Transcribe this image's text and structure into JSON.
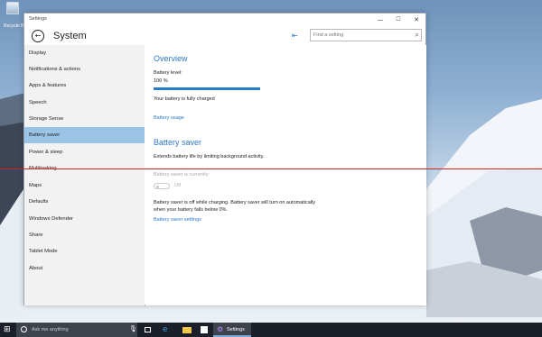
{
  "desktop": {
    "recycle_label": "Recycle Bin"
  },
  "window": {
    "title": "Settings",
    "controls": {
      "minimize": "—",
      "maximize": "☐",
      "close": "✕"
    }
  },
  "header": {
    "back_glyph": "←",
    "page_title": "System",
    "pin_glyph": "⇤",
    "search_placeholder": "Find a setting",
    "search_glyph": "⌕"
  },
  "sidebar": {
    "items": [
      {
        "label": "Display"
      },
      {
        "label": "Notifications & actions"
      },
      {
        "label": "Apps & features"
      },
      {
        "label": "Speech"
      },
      {
        "label": "Storage Sense"
      },
      {
        "label": "Battery saver",
        "selected": true
      },
      {
        "label": "Power & sleep"
      },
      {
        "label": "Multitasking"
      },
      {
        "label": "Maps"
      },
      {
        "label": "Defaults"
      },
      {
        "label": "Windows Defender"
      },
      {
        "label": "Share"
      },
      {
        "label": "Tablet Mode"
      },
      {
        "label": "About"
      }
    ]
  },
  "content": {
    "overview_title": "Overview",
    "battery_level_label": "Battery level:",
    "battery_level_value": "100 %",
    "battery_level_fraction": 1.0,
    "battery_status": "Your battery is fully charged",
    "battery_usage_link": "Battery usage",
    "saver_title": "Battery saver",
    "saver_desc": "Extends battery life by limiting background activity.",
    "saver_current_label": "Battery saver is currently:",
    "toggle_state": "Off",
    "saver_note": "Battery saver is off while charging. Battery saver will turn on automatically when your battery falls below 0%.",
    "saver_settings_link": "Battery saver settings"
  },
  "colors": {
    "accent": "#2b78c6",
    "selected_bg": "#9bc3e6",
    "overlay_line": "#d32020"
  },
  "taskbar": {
    "start_glyph": "⊞",
    "cortana_placeholder": "Ask me anything",
    "mic_glyph": "🎙",
    "edge_glyph": "e",
    "settings_glyph": "⚙",
    "settings_label": "Settings"
  }
}
